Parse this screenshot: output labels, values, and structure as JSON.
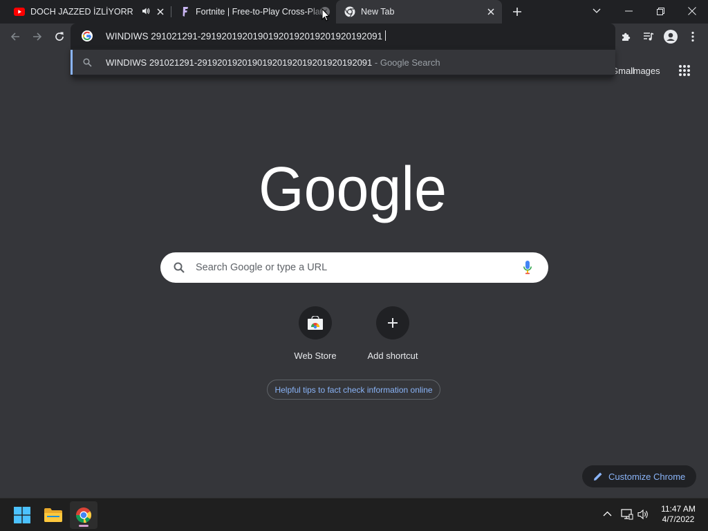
{
  "tabs": [
    {
      "title": "DOCH JAZZED İZLİYORR - PUBG",
      "icon": "youtube-icon",
      "audio": true
    },
    {
      "title": "Fortnite | Free-to-Play Cross-Platform",
      "icon": "fortnite-icon"
    },
    {
      "title": "New Tab",
      "icon": "chrome-icon",
      "active": true
    }
  ],
  "omnibox": {
    "value": "WINDIWS 291021291-29192019201901920192019201920192091"
  },
  "suggestion": {
    "query": "WINDIWS 291021291-29192019201901920192019201920192091",
    "suffix": " - Google Search"
  },
  "page": {
    "gmail": "Gmail",
    "images": "Images",
    "search_placeholder": "Search Google or type a URL",
    "shortcuts": [
      {
        "label": "Web Store",
        "icon": "web-store-icon"
      },
      {
        "label": "Add shortcut",
        "icon": "plus-icon"
      }
    ],
    "tips": "Helpful tips to fact check information online",
    "customize": "Customize Chrome"
  },
  "taskbar": {
    "time": "11:47 AM",
    "date": "4/7/2022"
  },
  "colors": {
    "tabstrip": "#202124",
    "toolbar": "#35363a",
    "accent": "#8ab4f8"
  }
}
